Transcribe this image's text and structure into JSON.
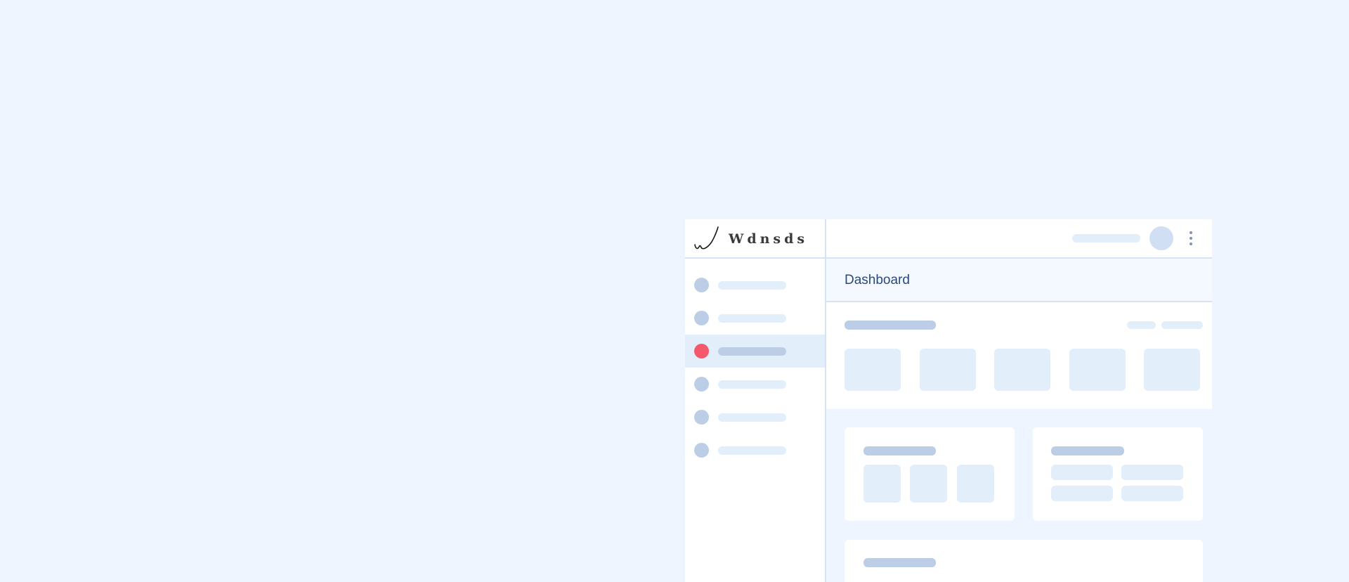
{
  "brand": {
    "name": "Wdnsds",
    "logo_icon": "signature-swoosh-icon"
  },
  "sidebar": {
    "items": [
      {
        "active": false
      },
      {
        "active": false
      },
      {
        "active": true,
        "accent_color": "#F5576C"
      },
      {
        "active": false
      },
      {
        "active": false
      },
      {
        "active": false
      }
    ]
  },
  "topbar": {
    "avatar_icon": "avatar",
    "menu_icon": "kebab-menu-icon"
  },
  "page": {
    "title": "Dashboard"
  },
  "colors": {
    "background": "#EEF5FF",
    "placeholder_dark": "#BCCDE6",
    "placeholder_light": "#E3EEFB",
    "title_text": "#2B4A7A",
    "active_dot": "#F5576C"
  }
}
